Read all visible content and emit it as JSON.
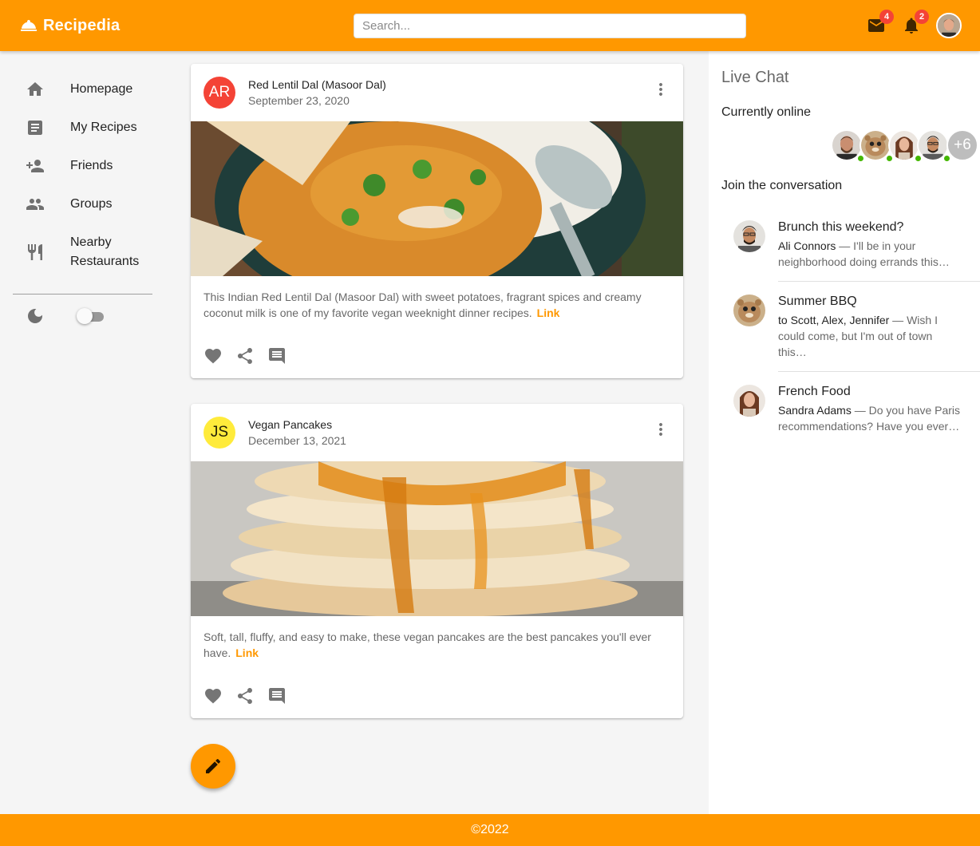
{
  "app": {
    "title": "Recipedia",
    "logo_icon": "room-service-icon",
    "footer": "©2022"
  },
  "topbar": {
    "search_placeholder": "Search...",
    "mail_badge": "4",
    "notifications_badge": "2"
  },
  "sidebar": {
    "items": [
      {
        "label": "Homepage",
        "icon": "home-icon"
      },
      {
        "label": "My Recipes",
        "icon": "article-icon"
      },
      {
        "label": "Friends",
        "icon": "person-add-icon"
      },
      {
        "label": "Groups",
        "icon": "group-icon"
      },
      {
        "label": "Nearby Restaurants",
        "icon": "restaurant-icon"
      }
    ],
    "dark_mode_icon": "moon-icon",
    "dark_mode_on": false
  },
  "posts": [
    {
      "avatar_initials": "AR",
      "avatar_color": "#f44336",
      "title": "Red Lentil Dal (Masoor Dal)",
      "date": "September 23, 2020",
      "description": "This Indian Red Lentil Dal (Masoor Dal) with sweet potatoes, fragrant spices and creamy coconut milk is one of my favorite vegan weeknight dinner recipes.",
      "link_label": "Link"
    },
    {
      "avatar_initials": "JS",
      "avatar_color": "#ffeb3b",
      "title": "Vegan Pancakes",
      "date": "December 13, 2021",
      "description": "Soft, tall, fluffy, and easy to make, these vegan pancakes are the best pancakes you'll ever have.",
      "link_label": "Link"
    }
  ],
  "live_chat": {
    "title": "Live Chat",
    "online_heading": "Currently online",
    "more_online": "+6",
    "join_heading": "Join the conversation",
    "conversations": [
      {
        "title": "Brunch this weekend?",
        "from": "Ali Connors",
        "snippet": " — I'll be in your neighborhood doing errands this…"
      },
      {
        "title": "Summer BBQ",
        "from": "to Scott, Alex, Jennifer",
        "snippet": " — Wish I could come, but I'm out of town this…"
      },
      {
        "title": "French Food",
        "from": "Sandra Adams",
        "snippet": " — Do you have Paris recommendations? Have you ever…"
      }
    ]
  },
  "colors": {
    "primary": "#ff9800",
    "badge": "#f44336",
    "online": "#44b700"
  }
}
